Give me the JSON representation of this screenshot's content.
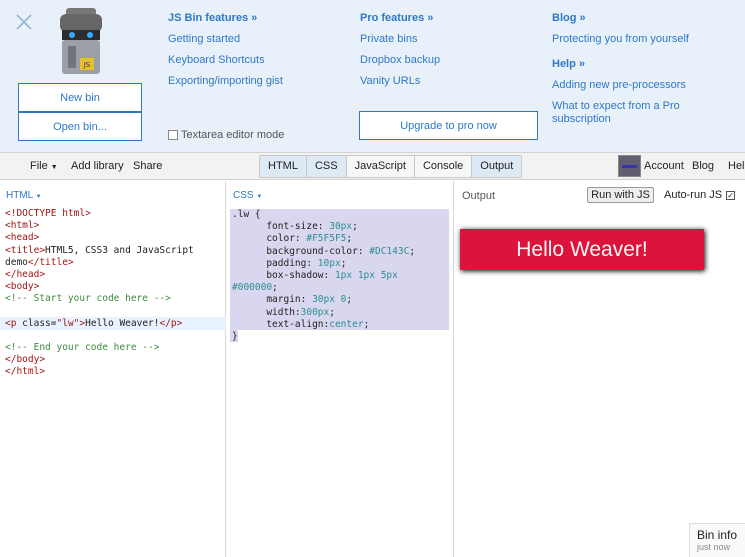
{
  "panel": {
    "side_buttons": {
      "new_bin": "New bin",
      "open_bin": "Open bin..."
    },
    "features": {
      "heading": "JS Bin features »",
      "links": [
        "Getting started",
        "Keyboard Shortcuts",
        "Exporting/importing gist"
      ]
    },
    "pro": {
      "heading": "Pro features »",
      "links": [
        "Private bins",
        "Dropbox backup",
        "Vanity URLs"
      ],
      "upgrade": "Upgrade to pro now"
    },
    "blog": {
      "heading": "Blog »",
      "link": "Protecting you from yourself"
    },
    "help": {
      "heading": "Help »",
      "links": [
        "Adding new pre-processors",
        "What to expect from a Pro subscription"
      ]
    },
    "textarea_mode": "Textarea editor mode"
  },
  "toolbar": {
    "file": "File",
    "add_library": "Add library",
    "share": "Share",
    "tabs": [
      "HTML",
      "CSS",
      "JavaScript",
      "Console",
      "Output"
    ],
    "account": "Account",
    "blog": "Blog",
    "help": "Help"
  },
  "panes": {
    "html_label": "HTML",
    "css_label": "CSS",
    "output_label": "Output",
    "run": "Run with JS",
    "autorun": "Auto-run JS",
    "autorun_checked": true
  },
  "html_code": [
    [
      {
        "c": "t",
        "s": "<!DOCTYPE html>"
      }
    ],
    [
      {
        "c": "t",
        "s": "<html>"
      }
    ],
    [
      {
        "c": "t",
        "s": "<head>"
      }
    ],
    [
      {
        "c": "t",
        "s": "<title>"
      },
      {
        "c": "",
        "s": "HTML5, CSS3 and JavaScript"
      }
    ],
    [
      {
        "c": "",
        "s": "demo"
      },
      {
        "c": "t",
        "s": "</title>"
      }
    ],
    [
      {
        "c": "t",
        "s": "</head>"
      }
    ],
    [
      {
        "c": "t",
        "s": "<body>"
      }
    ],
    [
      {
        "c": "cm",
        "s": "<!-- Start your code here -->"
      }
    ],
    [
      {
        "c": "",
        "s": ""
      }
    ],
    [
      {
        "c": "t",
        "s": "<p "
      },
      {
        "c": "",
        "s": "class="
      },
      {
        "c": "t",
        "s": "\"lw\""
      },
      {
        "c": "t",
        "s": ">"
      },
      {
        "c": "",
        "s": "Hello Weaver!"
      },
      {
        "c": "t",
        "s": "</p>"
      }
    ],
    [
      {
        "c": "",
        "s": ""
      }
    ],
    [
      {
        "c": "cm",
        "s": "<!-- End your code here -->"
      }
    ],
    [
      {
        "c": "t",
        "s": "</body>"
      }
    ],
    [
      {
        "c": "t",
        "s": "</html>"
      }
    ]
  ],
  "css_code": [
    [
      {
        "c": "",
        "s": ".lw {"
      }
    ],
    [
      {
        "c": "",
        "s": "      font-size: "
      },
      {
        "c": "v",
        "s": "30px"
      },
      {
        "c": "",
        "s": ";"
      }
    ],
    [
      {
        "c": "",
        "s": "      color: "
      },
      {
        "c": "v",
        "s": "#F5F5F5"
      },
      {
        "c": "",
        "s": ";"
      }
    ],
    [
      {
        "c": "",
        "s": "      background-color: "
      },
      {
        "c": "v",
        "s": "#DC143C"
      },
      {
        "c": "",
        "s": ";"
      }
    ],
    [
      {
        "c": "",
        "s": "      padding: "
      },
      {
        "c": "v",
        "s": "10px"
      },
      {
        "c": "",
        "s": ";"
      }
    ],
    [
      {
        "c": "",
        "s": "      box-shadow: "
      },
      {
        "c": "v",
        "s": "1px 1px 5px"
      }
    ],
    [
      {
        "c": "v",
        "s": "#000000"
      },
      {
        "c": "",
        "s": ";"
      }
    ],
    [
      {
        "c": "",
        "s": "      margin: "
      },
      {
        "c": "v",
        "s": "30px 0"
      },
      {
        "c": "",
        "s": ";"
      }
    ],
    [
      {
        "c": "",
        "s": "      width:"
      },
      {
        "c": "v",
        "s": "300px"
      },
      {
        "c": "",
        "s": ";"
      }
    ],
    [
      {
        "c": "",
        "s": "      text-align:"
      },
      {
        "c": "v",
        "s": "center"
      },
      {
        "c": "",
        "s": ";"
      }
    ],
    [
      {
        "c": "",
        "s": "}"
      }
    ]
  ],
  "output": {
    "text": "Hello Weaver!",
    "bg": "#DC143C",
    "fg": "#F5F5F5"
  },
  "bin_info": {
    "title": "Bin info",
    "sub": "just now"
  },
  "colors": {
    "accent": "#2e78c6",
    "panel_bg": "#e8f1fa"
  }
}
